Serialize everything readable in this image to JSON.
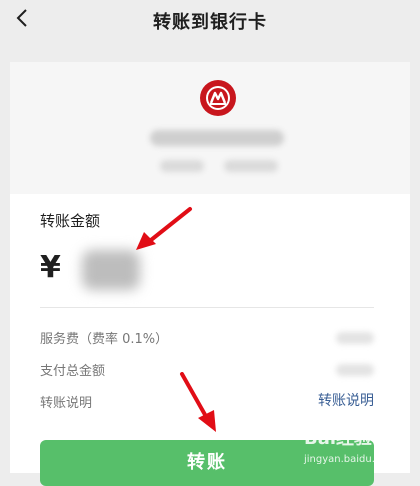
{
  "header": {
    "title": "转账到银行卡"
  },
  "payee": {
    "bank_logo_icon": "bank-logo-icon",
    "bank_color": "#c8161d"
  },
  "amount": {
    "label": "转账金额",
    "currency": "¥"
  },
  "rows": {
    "service_fee_label": "服务费（费率 0.1%）",
    "total_label": "支付总金额",
    "note_label": "转账说明",
    "note_link": "转账说明"
  },
  "actions": {
    "transfer_label": "转账"
  },
  "watermark": {
    "text_main": "Bai经验",
    "text_sub": "jingyan.baidu.com"
  },
  "colors": {
    "accent": "#57bf6a",
    "link": "#3a5f95",
    "annotation_arrow": "#e10d16"
  }
}
